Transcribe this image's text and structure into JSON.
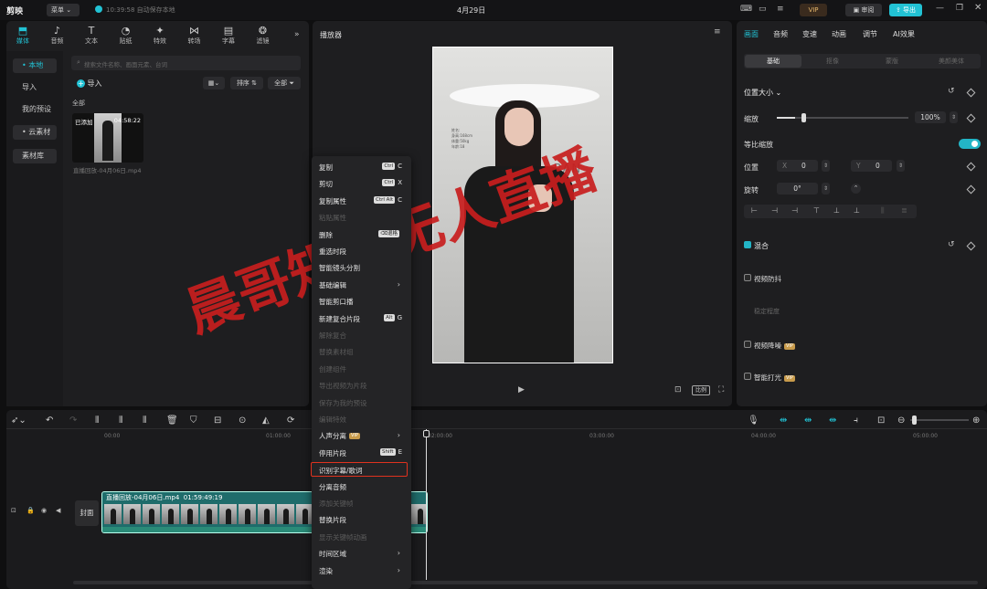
{
  "app": {
    "logo": "剪映",
    "menu": "菜单",
    "save_status": "10:39:58 自动保存本地",
    "title": "4月29日",
    "vip": "VIP",
    "review": "审阅",
    "export": "导出"
  },
  "media_tabs": [
    {
      "label": "媒体",
      "icon": "media-icon"
    },
    {
      "label": "音频",
      "icon": "audio-icon"
    },
    {
      "label": "文本",
      "icon": "text-icon"
    },
    {
      "label": "贴纸",
      "icon": "sticker-icon"
    },
    {
      "label": "特效",
      "icon": "effects-icon"
    },
    {
      "label": "转场",
      "icon": "transition-icon"
    },
    {
      "label": "字幕",
      "icon": "subtitle-icon"
    },
    {
      "label": "滤镜",
      "icon": "filter-icon"
    }
  ],
  "sidebar": {
    "items": [
      "• 本地",
      "导入",
      "我的预设",
      "• 云素材",
      "素材库"
    ]
  },
  "library": {
    "search_placeholder": "搜索文件名称、画面元素、台词",
    "import": "导入",
    "sort": "排序",
    "all": "全部",
    "section": "全部",
    "clip_added": "已添加",
    "clip_duration": "04:58:22",
    "clip_name": "直播回放-04月06日.mp4"
  },
  "player": {
    "title": "播放器",
    "watermark": "晨哥矩阵无人直播",
    "ratio": "比例",
    "overlay_lines": [
      "姓名:",
      "身高:168cm",
      "体重:50kg",
      "年龄:18"
    ],
    "bg_text": "RAN"
  },
  "context_menu": {
    "items": [
      {
        "label": "复制",
        "shortcut_mod": "Ctrl",
        "shortcut_key": "C",
        "disabled": false
      },
      {
        "label": "剪切",
        "shortcut_mod": "Ctrl",
        "shortcut_key": "X",
        "disabled": false
      },
      {
        "label": "复制属性",
        "shortcut_mod": "Ctrl  Alt",
        "shortcut_key": "C",
        "disabled": false
      },
      {
        "label": "粘贴属性",
        "disabled": true
      },
      {
        "label": "删除",
        "shortcut_mod": "⌫退格",
        "shortcut_key": "",
        "disabled": false
      },
      {
        "label": "重选时段",
        "disabled": false
      },
      {
        "label": "智能镜头分割",
        "disabled": false
      },
      {
        "label": "基础编辑",
        "submenu": true,
        "disabled": false
      },
      {
        "label": "智能剪口播",
        "disabled": false
      },
      {
        "label": "新建复合片段",
        "shortcut_mod": "Alt",
        "shortcut_key": "G",
        "disabled": false
      },
      {
        "label": "解除复合",
        "disabled": true
      },
      {
        "label": "替换素材组",
        "disabled": true
      },
      {
        "label": "创建组件",
        "disabled": true
      },
      {
        "label": "导出视频为片段",
        "disabled": true
      },
      {
        "label": "保存为我的预设",
        "disabled": true
      },
      {
        "label": "编辑特效",
        "disabled": true
      },
      {
        "label": "人声分离",
        "vip": "VIP",
        "submenu": true,
        "disabled": false
      },
      {
        "label": "停用片段",
        "shortcut_mod": "Shift",
        "shortcut_key": "E",
        "disabled": false
      },
      {
        "label": "识别字幕/歌词",
        "highlight": true,
        "disabled": false
      },
      {
        "label": "分离音频",
        "disabled": false
      },
      {
        "label": "添加关键帧",
        "disabled": true
      },
      {
        "label": "替换片段",
        "disabled": false
      },
      {
        "label": "显示关键帧动画",
        "disabled": true
      },
      {
        "label": "时间区域",
        "submenu": true,
        "disabled": false
      },
      {
        "label": "渲染",
        "submenu": true,
        "disabled": false
      }
    ]
  },
  "props": {
    "tabs": [
      "画面",
      "音频",
      "变速",
      "动画",
      "调节",
      "AI效果"
    ],
    "subtabs": [
      "基础",
      "抠像",
      "蒙版",
      "美颜美体"
    ],
    "position_size": "位置大小",
    "scale": "缩放",
    "scale_value": "100%",
    "scale_level": 1.0,
    "uniform_scale": "等比缩放",
    "position": "位置",
    "pos_x_label": "X",
    "pos_x": "0",
    "pos_y_label": "Y",
    "pos_y": "0",
    "rotation": "旋转",
    "rotation_value": "0°",
    "blend": "混合",
    "stabilize": "视频防抖",
    "stabilize_level": "稳定程度",
    "denoise": "视频降噪",
    "smart_light": "智能打光",
    "vip": "VIP"
  },
  "timeline": {
    "ruler": [
      "00:00",
      "01:00:00",
      "02:00:00",
      "03:00:00",
      "04:00:00",
      "05:00:00"
    ],
    "cover": "封面",
    "clip_name": "直播回放-04月06日.mp4",
    "clip_duration": "01:59:49:19"
  },
  "colors": {
    "accent": "#22c2d4",
    "clip": "#1f6c6b",
    "watermark": "#c81e1e",
    "highlight": "#e0321e",
    "vip": "#c89b4b"
  }
}
